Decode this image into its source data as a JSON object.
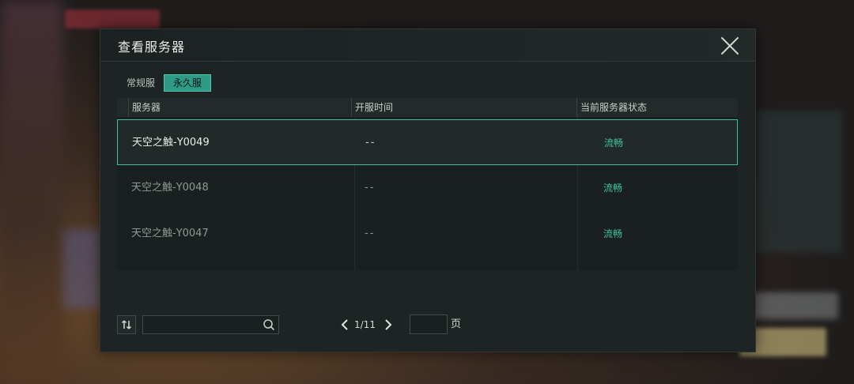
{
  "dialog": {
    "title": "查看服务器"
  },
  "tabs": [
    {
      "label": "常规服",
      "active": false
    },
    {
      "label": "永久服",
      "active": true
    }
  ],
  "table": {
    "headers": [
      "服务器",
      "开服时间",
      "当前服务器状态"
    ],
    "rows": [
      {
        "name": "天空之触-Y0049",
        "open_time": "--",
        "status": "流畅",
        "selected": true
      },
      {
        "name": "天空之触-Y0048",
        "open_time": "--",
        "status": "流畅",
        "selected": false
      },
      {
        "name": "天空之触-Y0047",
        "open_time": "--",
        "status": "流畅",
        "selected": false
      }
    ]
  },
  "footer": {
    "sort_icon": "sort-swap-icon",
    "search_value": "",
    "search_icon": "search-icon",
    "page_indicator": "1/11",
    "page_input_value": "",
    "page_unit": "页"
  },
  "colors": {
    "accent": "#3fbf9f",
    "status_good": "#3fc49f",
    "dialog_bg": "#1d2423"
  }
}
